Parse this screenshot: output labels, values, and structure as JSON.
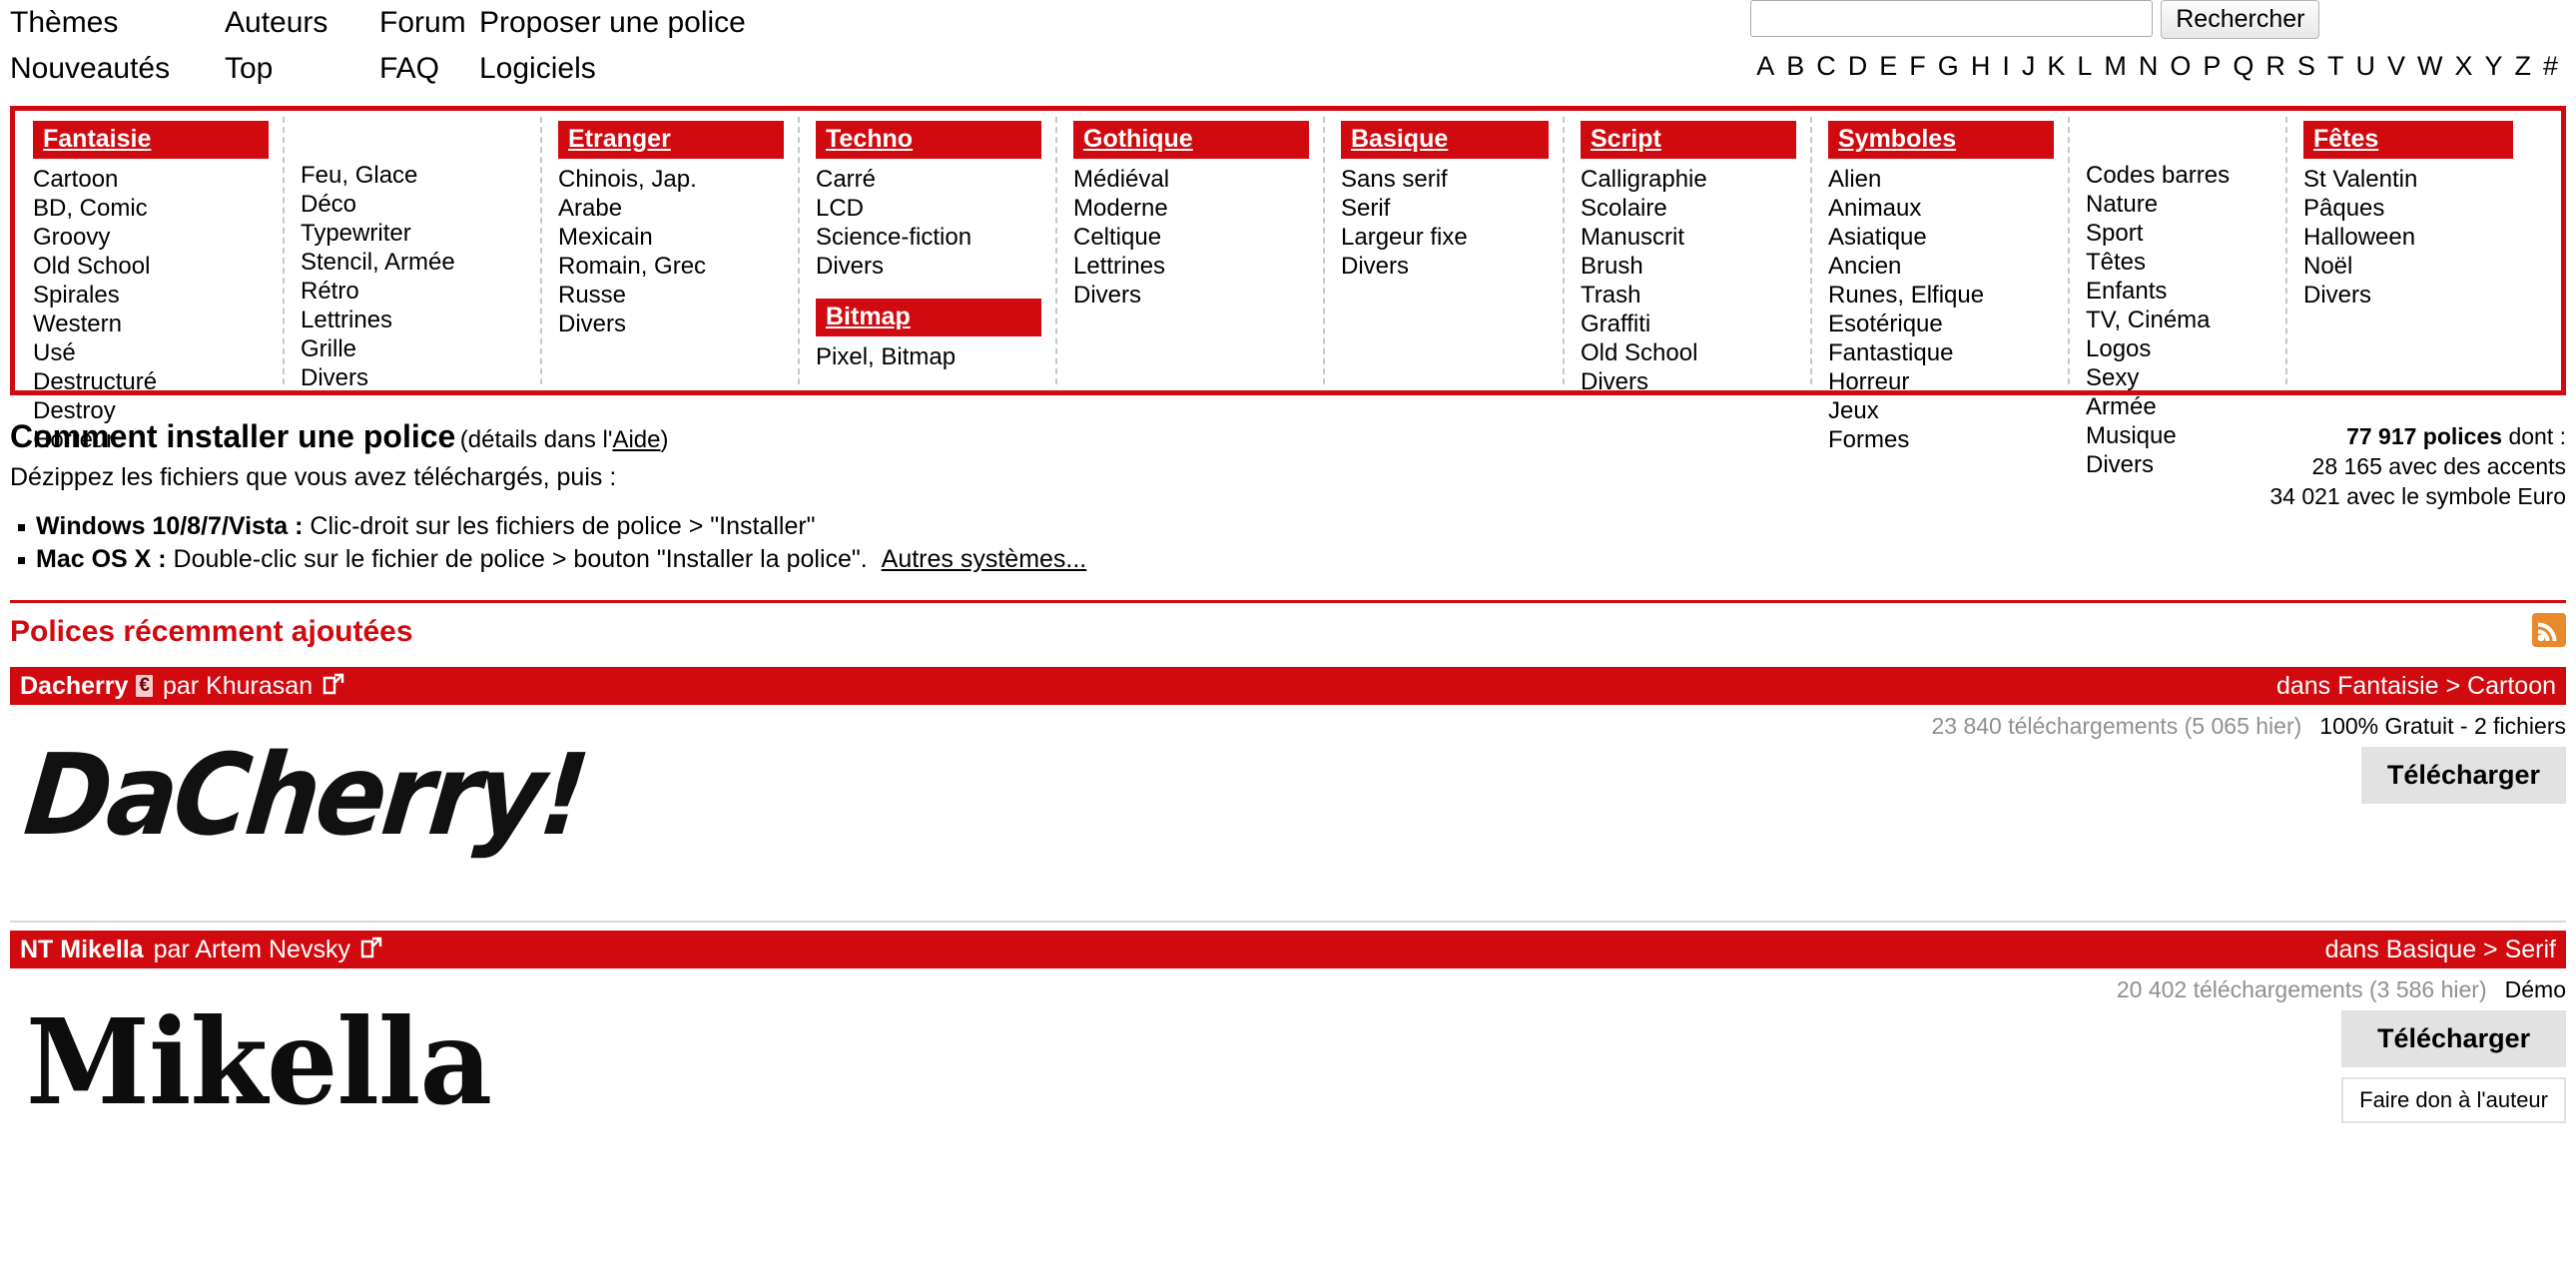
{
  "nav": {
    "row1": [
      "Thèmes",
      "Auteurs",
      "Forum",
      "Proposer une police"
    ],
    "row2": [
      "Nouveautés",
      "Top",
      "FAQ",
      "Logiciels"
    ]
  },
  "search": {
    "value": "",
    "placeholder": "",
    "button_label": "Rechercher"
  },
  "alphabet": [
    "A",
    "B",
    "C",
    "D",
    "E",
    "F",
    "G",
    "H",
    "I",
    "J",
    "K",
    "L",
    "M",
    "N",
    "O",
    "P",
    "Q",
    "R",
    "S",
    "T",
    "U",
    "V",
    "W",
    "X",
    "Y",
    "Z",
    "#"
  ],
  "categories": [
    {
      "title": "Fantaisie",
      "items": [
        "Cartoon",
        "BD, Comic",
        "Groovy",
        "Old School",
        "Spirales",
        "Western",
        "Usé",
        "Destructuré",
        "Destroy",
        "Horreur"
      ]
    },
    {
      "title": "",
      "items": [
        "Feu, Glace",
        "Déco",
        "Typewriter",
        "Stencil, Armée",
        "Rétro",
        "Lettrines",
        "Grille",
        "Divers"
      ]
    },
    {
      "title": "Etranger",
      "items": [
        "Chinois, Jap.",
        "Arabe",
        "Mexicain",
        "Romain, Grec",
        "Russe",
        "Divers"
      ]
    },
    {
      "title": "Techno",
      "items": [
        "Carré",
        "LCD",
        "Science-fiction",
        "Divers"
      ],
      "title2": "Bitmap",
      "items2": [
        "Pixel, Bitmap"
      ]
    },
    {
      "title": "Gothique",
      "items": [
        "Médiéval",
        "Moderne",
        "Celtique",
        "Lettrines",
        "Divers"
      ]
    },
    {
      "title": "Basique",
      "items": [
        "Sans serif",
        "Serif",
        "Largeur fixe",
        "Divers"
      ]
    },
    {
      "title": "Script",
      "items": [
        "Calligraphie",
        "Scolaire",
        "Manuscrit",
        "Brush",
        "Trash",
        "Graffiti",
        "Old School",
        "Divers"
      ]
    },
    {
      "title": "Symboles",
      "items": [
        "Alien",
        "Animaux",
        "Asiatique",
        "Ancien",
        "Runes, Elfique",
        "Esotérique",
        "Fantastique",
        "Horreur",
        "Jeux",
        "Formes"
      ]
    },
    {
      "title": "",
      "items": [
        "Codes barres",
        "Nature",
        "Sport",
        "Têtes",
        "Enfants",
        "TV, Cinéma",
        "Logos",
        "Sexy",
        "Armée",
        "Musique",
        "Divers"
      ]
    },
    {
      "title": "Fêtes",
      "items": [
        "St Valentin",
        "Pâques",
        "Halloween",
        "Noël",
        "Divers"
      ]
    }
  ],
  "install": {
    "heading": "Comment installer une police",
    "heading_sub_open": "(détails dans l'",
    "heading_sub_link": "Aide",
    "heading_sub_close": ")",
    "subtitle": "Dézippez les fichiers que vous avez téléchargés, puis :",
    "items": [
      {
        "label": "Windows 10/8/7/Vista :",
        "text": " Clic-droit sur les fichiers de police > \"Installer\"",
        "link": ""
      },
      {
        "label": "Mac OS X :",
        "text": " Double-clic sur le fichier de police > bouton \"Installer la police\".",
        "link": "Autres systèmes..."
      }
    ]
  },
  "stats": {
    "total_bold": "77 917 polices",
    "total_suffix": " dont :",
    "line2": "28 165 avec des accents",
    "line3": "34 021 avec le symbole Euro"
  },
  "recent": {
    "title": "Polices récemment ajoutées",
    "rss_icon": "rss-icon",
    "fonts": [
      {
        "name": "Dacherry",
        "euro_badge": "€",
        "has_euro": true,
        "by_label": "par",
        "author": "Khurasan",
        "external_icon": "external-link-icon",
        "category_path": "dans Fantaisie > Cartoon",
        "downloads": "23 840 téléchargements (5 065 hier)",
        "license": "100% Gratuit - 2 fichiers",
        "demo": "",
        "download_label": "Télécharger",
        "donate_label": "",
        "preview_text": "DaCherry!"
      },
      {
        "name": "NT Mikella",
        "euro_badge": "",
        "has_euro": false,
        "by_label": "par",
        "author": "Artem Nevsky",
        "external_icon": "external-link-icon",
        "category_path": "dans Basique > Serif",
        "downloads": "20 402 téléchargements (3 586 hier)",
        "license": "",
        "demo": "Démo",
        "download_label": "Télécharger",
        "donate_label": "Faire don à l'auteur",
        "preview_text": "Mikella"
      }
    ]
  },
  "colors": {
    "brand_red": "#d10a10",
    "rss_orange": "#e8892b",
    "button_gray": "#e2e2e2",
    "muted_gray": "#909090"
  }
}
